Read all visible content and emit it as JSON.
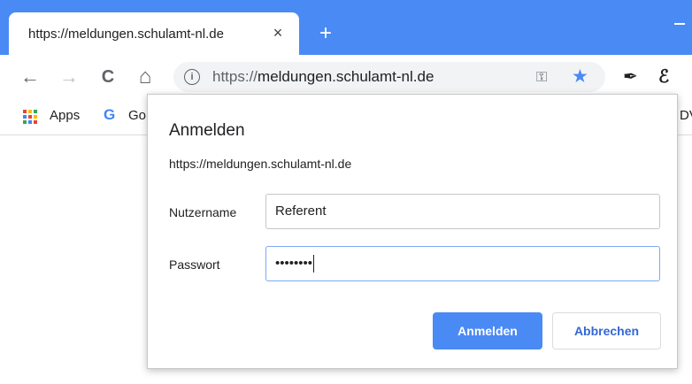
{
  "tab": {
    "title": "https://meldungen.schulamt-nl.de",
    "close_icon": "×",
    "new_tab_icon": "+"
  },
  "toolbar": {
    "back_icon": "←",
    "forward_icon": "→",
    "reload_icon": "C",
    "home_icon": "⌂",
    "url_scheme": "https://",
    "url_host": "meldungen.schulamt-nl.de",
    "info_icon": "i",
    "key_icon": "⚿",
    "star_icon": "★",
    "ext1_icon": "✒",
    "ext2_icon": "ℰ"
  },
  "bookmarks": {
    "apps_label": "Apps",
    "google_label": "Go",
    "google_icon": "G",
    "right_fragment": "DV",
    "apps_colors": [
      "#ea4335",
      "#fbbc05",
      "#34a853",
      "#4285f4",
      "#ea4335",
      "#fbbc05",
      "#34a853",
      "#4285f4",
      "#ea4335"
    ]
  },
  "dialog": {
    "title": "Anmelden",
    "origin": "https://meldungen.schulamt-nl.de",
    "username_label": "Nutzername",
    "username_value": "Referent",
    "password_label": "Passwort",
    "password_value": "••••••••",
    "submit_label": "Anmelden",
    "cancel_label": "Abbrechen"
  },
  "colors": {
    "accent": "#4a8af4",
    "cancel_text": "#3367d6"
  }
}
